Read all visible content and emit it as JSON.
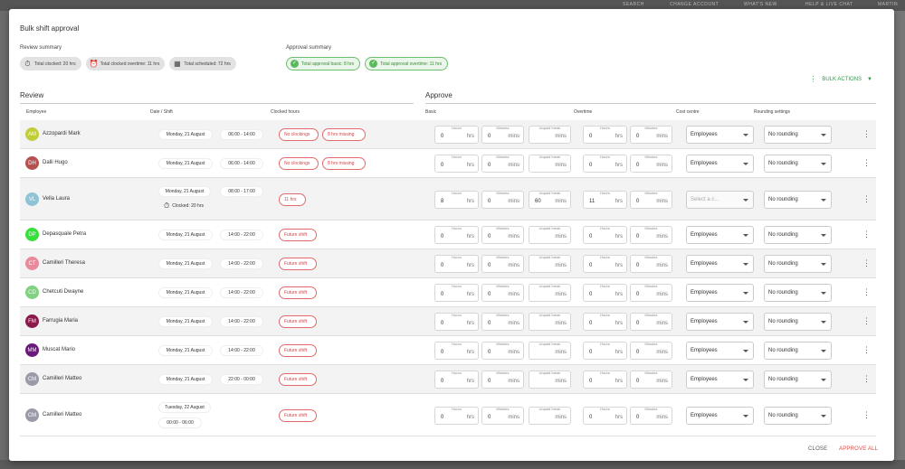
{
  "background": {
    "menu_items": [
      "SEARCH",
      "CHANGE ACCOUNT",
      "WHAT'S NEW",
      "HELP & LIVE CHAT",
      "MARTIN"
    ]
  },
  "modal": {
    "title": "Bulk shift approval",
    "review_summary": {
      "label": "Review summary",
      "chips": [
        {
          "icon": "stopwatch-icon",
          "text": "Total clocked: 20 hrs"
        },
        {
          "icon": "alarm-clock-icon",
          "text": "Total clocked overtime: 11 hrs"
        },
        {
          "icon": "calendar-icon",
          "text": "Total scheduled: 72 hrs"
        }
      ]
    },
    "approval_summary": {
      "label": "Approval summary",
      "chips": [
        {
          "icon": "check-circle-icon",
          "text": "Total approval basic: 8 hrs"
        },
        {
          "icon": "check-circle-icon",
          "text": "Total approval overtime: 11 hrs"
        }
      ]
    },
    "bulk_actions": "BULK ACTIONS",
    "sections": {
      "review": "Review",
      "approve": "Approve"
    },
    "columns": {
      "employee": "Employee",
      "date_shift": "Date / Shift",
      "clocked_hours": "Clocked hours",
      "basic": "Basic",
      "overtime": "Overtime",
      "cost_centre": "Cost centre",
      "rounding": "Rounding settings"
    },
    "field_labels": {
      "hours": "Hours",
      "minutes": "Minutes",
      "unpaid_break": "Unpaid break"
    },
    "units": {
      "hrs": "hrs",
      "mins": "mins"
    },
    "rows": [
      {
        "initials": "AM",
        "name": "Azzopardi Mark",
        "avatar_color": "#c2cd3c",
        "date": "Monday, 21 August",
        "shift": "06:00 - 14:00",
        "clocked": null,
        "tags": [
          "No clockings",
          "8 hrs missing"
        ],
        "basic_h": "0",
        "basic_m": "0",
        "break": "",
        "ot_h": "0",
        "ot_m": "0",
        "cost_centre": "Employees",
        "rounding": "No rounding"
      },
      {
        "initials": "DH",
        "name": "Dalli Hugo",
        "avatar_color": "#b5524f",
        "date": "Monday, 21 August",
        "shift": "06:00 - 14:00",
        "clocked": null,
        "tags": [
          "No clockings",
          "8 hrs missing"
        ],
        "basic_h": "0",
        "basic_m": "0",
        "break": "",
        "ot_h": "0",
        "ot_m": "0",
        "cost_centre": "Employees",
        "rounding": "No rounding"
      },
      {
        "initials": "VL",
        "name": "Vella Laura",
        "avatar_color": "#8fc4d8",
        "date": "Monday, 21 August",
        "shift": "08:00 - 17:00",
        "clocked": "Clocked: 20 hrs",
        "tags": [
          "11 hrs"
        ],
        "basic_h": "8",
        "basic_m": "0",
        "break": "60",
        "ot_h": "11",
        "ot_m": "0",
        "cost_centre": "Select a c...",
        "rounding": "No rounding"
      },
      {
        "initials": "DP",
        "name": "Depasquale Petra",
        "avatar_color": "#35e03a",
        "date": "Monday, 21 August",
        "shift": "14:00 - 22:00",
        "clocked": null,
        "tags": [
          "Future shift"
        ],
        "basic_h": "0",
        "basic_m": "0",
        "break": "",
        "ot_h": "0",
        "ot_m": "0",
        "cost_centre": "Employees",
        "rounding": "No rounding"
      },
      {
        "initials": "CT",
        "name": "Camilleri Theresa",
        "avatar_color": "#e88a9a",
        "date": "Monday, 21 August",
        "shift": "14:00 - 22:00",
        "clocked": null,
        "tags": [
          "Future shift"
        ],
        "basic_h": "0",
        "basic_m": "0",
        "break": "",
        "ot_h": "0",
        "ot_m": "0",
        "cost_centre": "Employees",
        "rounding": "No rounding"
      },
      {
        "initials": "CD",
        "name": "Chetcuti Dwayne",
        "avatar_color": "#7fd27f",
        "date": "Monday, 21 August",
        "shift": "14:00 - 22:00",
        "clocked": null,
        "tags": [
          "Future shift"
        ],
        "basic_h": "0",
        "basic_m": "0",
        "break": "",
        "ot_h": "0",
        "ot_m": "0",
        "cost_centre": "Employees",
        "rounding": "No rounding"
      },
      {
        "initials": "FM",
        "name": "Farrugia Maria",
        "avatar_color": "#8b1a4a",
        "date": "Monday, 21 August",
        "shift": "14:00 - 22:00",
        "clocked": null,
        "tags": [
          "Future shift"
        ],
        "basic_h": "0",
        "basic_m": "0",
        "break": "",
        "ot_h": "0",
        "ot_m": "0",
        "cost_centre": "Employees",
        "rounding": "No rounding"
      },
      {
        "initials": "MM",
        "name": "Muscat Mario",
        "avatar_color": "#6a1a7a",
        "date": "Monday, 21 August",
        "shift": "14:00 - 22:00",
        "clocked": null,
        "tags": [
          "Future shift"
        ],
        "basic_h": "0",
        "basic_m": "0",
        "break": "",
        "ot_h": "0",
        "ot_m": "0",
        "cost_centre": "Employees",
        "rounding": "No rounding"
      },
      {
        "initials": "CM",
        "name": "Camilleri Matteo",
        "avatar_color": "#9a9aa8",
        "date": "Monday, 21 August",
        "shift": "22:00 - 00:00",
        "clocked": null,
        "tags": [
          "Future shift"
        ],
        "basic_h": "0",
        "basic_m": "0",
        "break": "",
        "ot_h": "0",
        "ot_m": "0",
        "cost_centre": "Employees",
        "rounding": "No rounding"
      },
      {
        "initials": "CM",
        "name": "Camilleri Matteo",
        "avatar_color": "#9a9aa8",
        "date": "Tuesday, 22 August",
        "shift": "00:00 - 06:00",
        "clocked": null,
        "tags": [
          "Future shift"
        ],
        "basic_h": "0",
        "basic_m": "0",
        "break": "",
        "ot_h": "0",
        "ot_m": "0",
        "cost_centre": "Employees",
        "rounding": "No rounding"
      }
    ],
    "footer": {
      "close": "CLOSE",
      "approve_all": "APPROVE ALL"
    }
  }
}
